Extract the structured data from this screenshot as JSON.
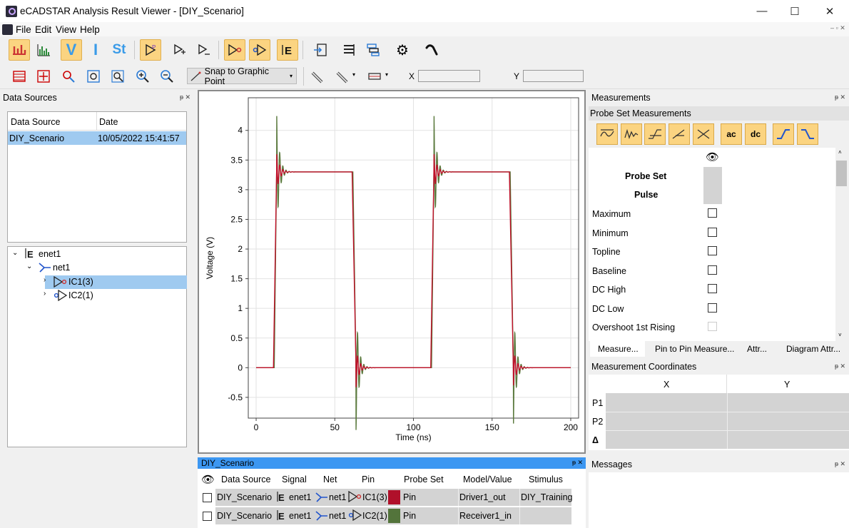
{
  "window": {
    "title": "eCADSTAR Analysis Result Viewer - [DIY_Scenario]",
    "minimize": "—",
    "maximize": "☐",
    "close": "✕"
  },
  "menu": [
    "File",
    "Edit",
    "View",
    "Help"
  ],
  "toolbar2": {
    "snap_label": "Snap to Graphic Point",
    "x_label": "X",
    "y_label": "Y",
    "x_value": "",
    "y_value": ""
  },
  "data_sources": {
    "title": "Data Sources",
    "columns": [
      "Data Source",
      "Date"
    ],
    "rows": [
      {
        "source": "DIY_Scenario",
        "date": "10/05/2022 15:41:57"
      }
    ],
    "tree": {
      "enet": "enet1",
      "net": "net1",
      "ic1": "IC1(3)",
      "ic2": "IC2(1)"
    }
  },
  "chart_data": {
    "type": "line",
    "xlabel": "Time (ns)",
    "ylabel": "Voltage (V)",
    "xlim": [
      -5,
      205
    ],
    "ylim": [
      -0.85,
      4.55
    ],
    "x_ticks": [
      0,
      50,
      100,
      150,
      200
    ],
    "y_ticks": [
      -0.5,
      0,
      0.5,
      1,
      1.5,
      2,
      2.5,
      3,
      3.5,
      4
    ],
    "grid": true,
    "series": [
      {
        "color": "#5b7a3e",
        "pulse": {
          "period": 100,
          "rise_start": 11.5,
          "rise_end": 13,
          "fall_start": 61.5,
          "fall_end": 63.5,
          "high": 3.3,
          "low": 0,
          "t_end": 200,
          "ring_amp": 1.05,
          "ring_decay": 1.7,
          "ring_period": 2.0
        }
      },
      {
        "color": "#c0102a",
        "pulse": {
          "period": 100,
          "rise_start": 11,
          "rise_end": 13,
          "fall_start": 61,
          "fall_end": 63.5,
          "high": 3.3,
          "low": 0,
          "t_end": 200,
          "ring_amp": 0.33,
          "ring_decay": 1.9,
          "ring_period": 2.0
        }
      }
    ]
  },
  "measurements": {
    "title": "Measurements",
    "subtitle": "Probe Set Measurements",
    "probe_set_label": "Probe Set",
    "pulse_label": "Pulse",
    "items": [
      {
        "label": "Maximum",
        "checked": false,
        "enabled": true
      },
      {
        "label": "Minimum",
        "checked": false,
        "enabled": true
      },
      {
        "label": "Topline",
        "checked": false,
        "enabled": true
      },
      {
        "label": "Baseline",
        "checked": false,
        "enabled": true
      },
      {
        "label": "DC High",
        "checked": false,
        "enabled": true
      },
      {
        "label": "DC Low",
        "checked": false,
        "enabled": true
      },
      {
        "label": "Overshoot 1st Rising",
        "checked": false,
        "enabled": false
      }
    ],
    "tabs": [
      "Measure...",
      "Pin to Pin Measure...",
      "Attr...",
      "Diagram Attr..."
    ]
  },
  "coords": {
    "title": "Measurement Coordinates",
    "x_header": "X",
    "y_header": "Y",
    "rows": [
      "P1",
      "P2",
      "Δ"
    ]
  },
  "messages": {
    "title": "Messages"
  },
  "scenario": {
    "title": "DIY_Scenario",
    "columns": [
      "Data Source",
      "Signal",
      "Net",
      "Pin",
      "Probe Set",
      "Model/Value",
      "Stimulus"
    ],
    "rows": [
      {
        "source": "DIY_Scenario",
        "signal": "enet1",
        "net": "net1",
        "pin": "IC1(3)",
        "color": "#b0102a",
        "probe": "Pin",
        "model": "Driver1_out",
        "stimulus": "DIY_Training"
      },
      {
        "source": "DIY_Scenario",
        "signal": "enet1",
        "net": "net1",
        "pin": "IC2(1)",
        "color": "#53743b",
        "probe": "Pin",
        "model": "Receiver1_in",
        "stimulus": ""
      }
    ]
  }
}
